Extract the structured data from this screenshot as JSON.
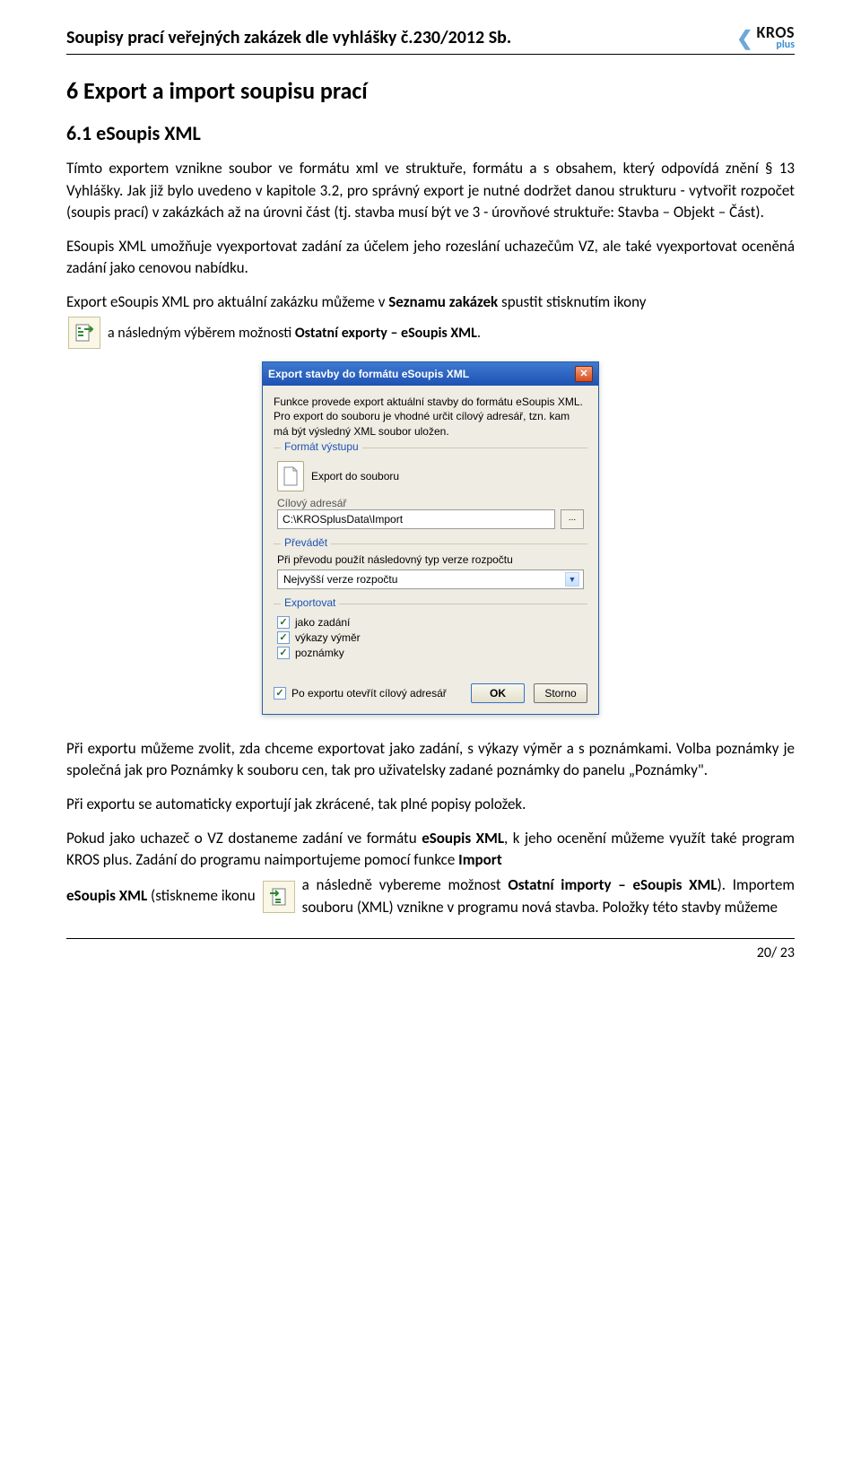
{
  "header": {
    "title": "Soupisy prací veřejných zakázek dle vyhlášky č.230/2012 Sb.",
    "logo": {
      "brand": "KROS",
      "sub": "plus"
    }
  },
  "section": {
    "number_title": "6  Export a import soupisu prací",
    "sub_title": "6.1 eSoupis XML"
  },
  "paragraphs": {
    "p1a": "Tímto exportem vznikne soubor ve formátu xml ve struktuře, formátu a s obsahem, který odpovídá znění § 13 Vyhlášky. Jak již bylo uvedeno v kapitole 3.2, pro správný export je nutné dodržet danou strukturu -   vytvořit rozpočet (soupis prací) v zakázkách až na úrovni část (tj. stavba musí být ve 3 - úrovňové struktuře: Stavba – Objekt – Část).",
    "p2": "ESoupis XML umožňuje vyexportovat zadání za účelem jeho rozeslání uchazečům VZ, ale také vyexportovat oceněná zadání jako cenovou nabídku.",
    "p3_lead": "Export eSoupis XML pro aktuální zakázku můžeme v ",
    "p3_bold1": "Seznamu zakázek",
    "p3_tail": " spustit stisknutím ikony",
    "p3_icon_after_a": " a následným výběrem možnosti ",
    "p3_bold2": "Ostatní exporty – eSoupis XML",
    "p3_period": ".",
    "p4": "Při exportu můžeme zvolit, zda chceme exportovat jako zadání, s výkazy výměr a s poznámkami. Volba poznámky je společná jak pro Poznámky k souboru cen, tak pro uživatelsky zadané poznámky do panelu „Poznámky\".",
    "p5": "Při exportu se automaticky exportují jak zkrácené, tak plné popisy položek.",
    "p6_a": "Pokud jako uchazeč o VZ dostaneme zadání ve formátu ",
    "p6_bold1": "eSoupis XML",
    "p6_b": ", k jeho ocenění můžeme využít také program KROS plus. Zadání do programu naimportujeme pomocí funkce ",
    "p6_bold2": "Import",
    "p7_a": "eSoupis XML",
    "p7_b": " (stiskneme ikonu ",
    "p7_c": " a následně vybereme možnost ",
    "p7_bold": "Ostatní importy – eSoupis XML",
    "p7_d": "). Importem souboru (XML) vznikne v programu nová stavba. Položky této stavby můžeme"
  },
  "dialog": {
    "title": "Export stavby do formátu eSoupis XML",
    "description": "Funkce provede export aktuální stavby do formátu eSoupis XML. Pro export do souboru je vhodné určit cílový adresář, tzn. kam má být výsledný XML soubor uložen.",
    "group_format": "Formát výstupu",
    "file_button_label": "Export do souboru",
    "dir_label": "Cílový adresář",
    "dir_value": "C:\\KROSplusData\\Import",
    "browse": "...",
    "group_convert": "Převádět",
    "convert_label": "Při převodu použít následovný typ verze rozpočtu",
    "convert_value": "Nejvyšší verze rozpočtu",
    "group_export": "Exportovat",
    "check1": "jako zadání",
    "check2": "výkazy výměr",
    "check3": "poznámky",
    "footer_check": "Po exportu otevřít cílový adresář",
    "ok": "OK",
    "cancel": "Storno"
  },
  "footer": {
    "page": "20/ 23"
  }
}
